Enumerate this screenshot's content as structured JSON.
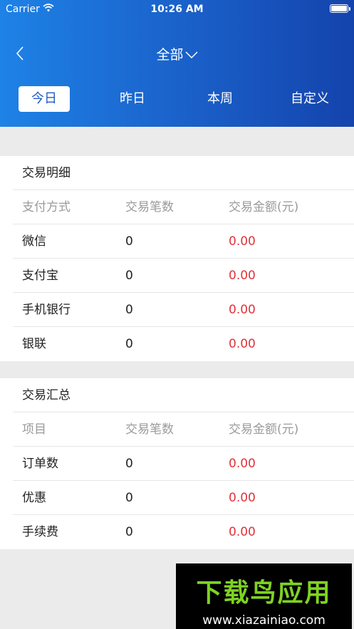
{
  "status_bar": {
    "carrier": "Carrier",
    "time": "10:26 AM"
  },
  "nav": {
    "title": "全部"
  },
  "tabs": [
    {
      "label": "今日",
      "active": true
    },
    {
      "label": "昨日",
      "active": false
    },
    {
      "label": "本周",
      "active": false
    },
    {
      "label": "自定义",
      "active": false
    }
  ],
  "details": {
    "title": "交易明细",
    "headers": [
      "支付方式",
      "交易笔数",
      "交易金额(元)"
    ],
    "rows": [
      {
        "name": "微信",
        "count": "0",
        "amount": "0.00"
      },
      {
        "name": "支付宝",
        "count": "0",
        "amount": "0.00"
      },
      {
        "name": "手机银行",
        "count": "0",
        "amount": "0.00"
      },
      {
        "name": "银联",
        "count": "0",
        "amount": "0.00"
      }
    ]
  },
  "summary": {
    "title": "交易汇总",
    "headers": [
      "项目",
      "交易笔数",
      "交易金额(元)"
    ],
    "rows": [
      {
        "name": "订单数",
        "count": "0",
        "amount": "0.00"
      },
      {
        "name": "优惠",
        "count": "0",
        "amount": "0.00"
      },
      {
        "name": "手续费",
        "count": "0",
        "amount": "0.00"
      }
    ]
  },
  "watermark": {
    "logo": "下载鸟应用",
    "url": "www.xiazainiao.com"
  },
  "colors": {
    "header_start": "#1e82e6",
    "header_end": "#1443ac",
    "amount": "#e0333b"
  }
}
